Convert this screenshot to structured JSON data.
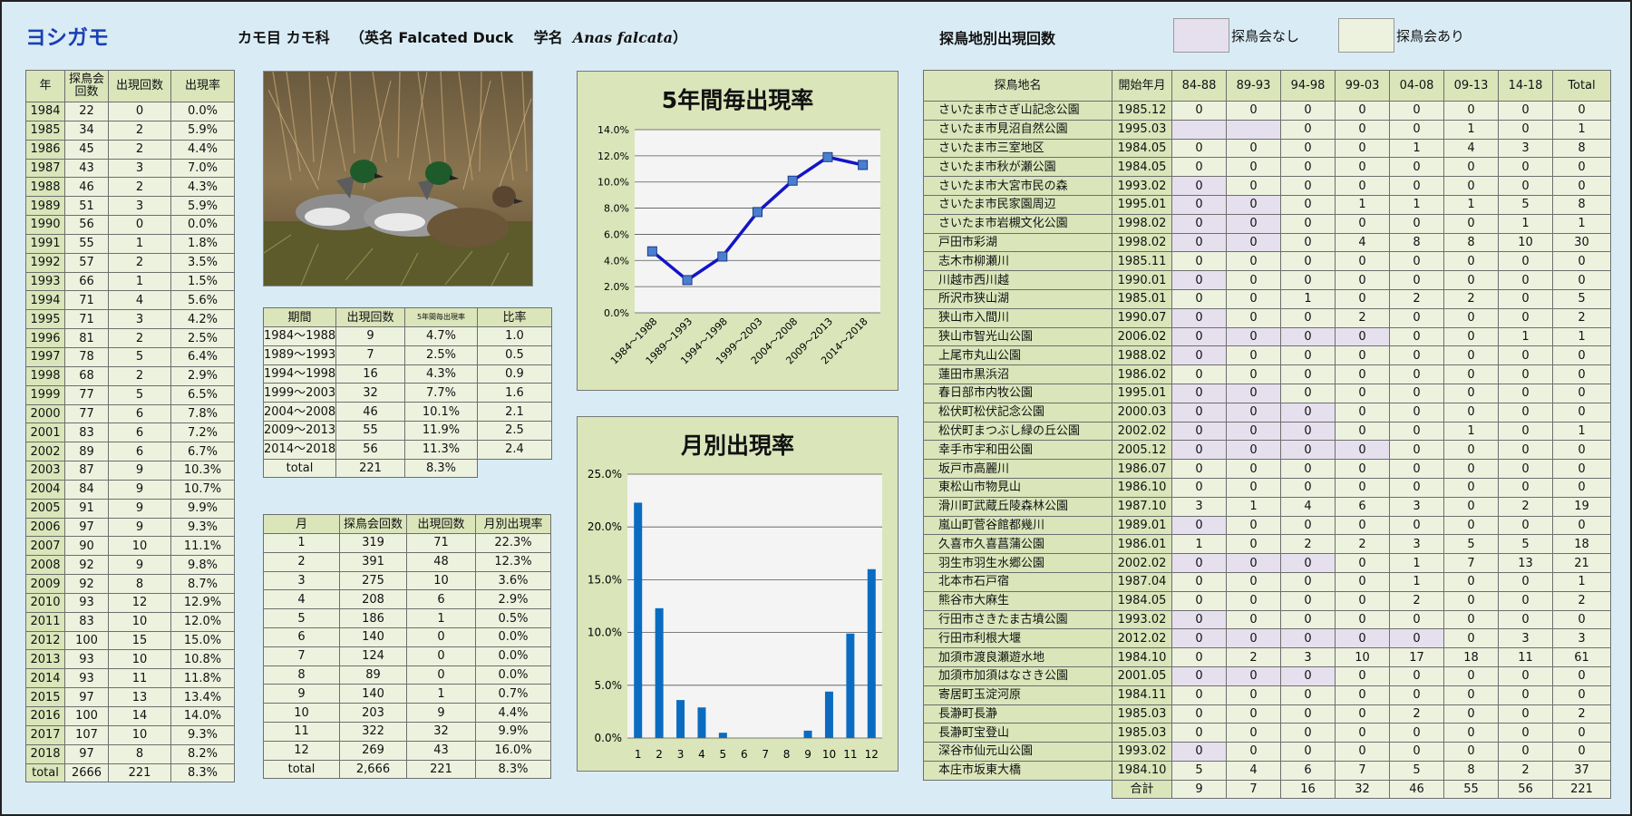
{
  "header": {
    "species": "ヨシガモ",
    "order_family": "カモ目 カモ科",
    "english_prefix": "（英名 Falcated Duck",
    "sci_prefix": "学名",
    "sci_name": "Anas falcata",
    "sci_suffix": "）",
    "site_table_title": "探鳥地別出現回数",
    "legend_none": "探鳥会なし",
    "legend_yes": "探鳥会あり",
    "legend_none_color": "#e6e0ee",
    "legend_yes_color": "#edf2df"
  },
  "yearly": {
    "headers": [
      "年",
      "探鳥会\n回数",
      "出現回数",
      "出現率"
    ],
    "rows": [
      [
        "1984",
        "22",
        "0",
        "0.0%"
      ],
      [
        "1985",
        "34",
        "2",
        "5.9%"
      ],
      [
        "1986",
        "45",
        "2",
        "4.4%"
      ],
      [
        "1987",
        "43",
        "3",
        "7.0%"
      ],
      [
        "1988",
        "46",
        "2",
        "4.3%"
      ],
      [
        "1989",
        "51",
        "3",
        "5.9%"
      ],
      [
        "1990",
        "56",
        "0",
        "0.0%"
      ],
      [
        "1991",
        "55",
        "1",
        "1.8%"
      ],
      [
        "1992",
        "57",
        "2",
        "3.5%"
      ],
      [
        "1993",
        "66",
        "1",
        "1.5%"
      ],
      [
        "1994",
        "71",
        "4",
        "5.6%"
      ],
      [
        "1995",
        "71",
        "3",
        "4.2%"
      ],
      [
        "1996",
        "81",
        "2",
        "2.5%"
      ],
      [
        "1997",
        "78",
        "5",
        "6.4%"
      ],
      [
        "1998",
        "68",
        "2",
        "2.9%"
      ],
      [
        "1999",
        "77",
        "5",
        "6.5%"
      ],
      [
        "2000",
        "77",
        "6",
        "7.8%"
      ],
      [
        "2001",
        "83",
        "6",
        "7.2%"
      ],
      [
        "2002",
        "89",
        "6",
        "6.7%"
      ],
      [
        "2003",
        "87",
        "9",
        "10.3%"
      ],
      [
        "2004",
        "84",
        "9",
        "10.7%"
      ],
      [
        "2005",
        "91",
        "9",
        "9.9%"
      ],
      [
        "2006",
        "97",
        "9",
        "9.3%"
      ],
      [
        "2007",
        "90",
        "10",
        "11.1%"
      ],
      [
        "2008",
        "92",
        "9",
        "9.8%"
      ],
      [
        "2009",
        "92",
        "8",
        "8.7%"
      ],
      [
        "2010",
        "93",
        "12",
        "12.9%"
      ],
      [
        "2011",
        "83",
        "10",
        "12.0%"
      ],
      [
        "2012",
        "100",
        "15",
        "15.0%"
      ],
      [
        "2013",
        "93",
        "10",
        "10.8%"
      ],
      [
        "2014",
        "93",
        "11",
        "11.8%"
      ],
      [
        "2015",
        "97",
        "13",
        "13.4%"
      ],
      [
        "2016",
        "100",
        "14",
        "14.0%"
      ],
      [
        "2017",
        "107",
        "10",
        "9.3%"
      ],
      [
        "2018",
        "97",
        "8",
        "8.2%"
      ]
    ],
    "total": [
      "total",
      "2666",
      "221",
      "8.3%"
    ]
  },
  "period": {
    "headers": [
      "期間",
      "出現回数",
      "5年間毎出現率",
      "比率"
    ],
    "rows": [
      [
        "1984～1988",
        "9",
        "4.7%",
        "1.0"
      ],
      [
        "1989～1993",
        "7",
        "2.5%",
        "0.5"
      ],
      [
        "1994～1998",
        "16",
        "4.3%",
        "0.9"
      ],
      [
        "1999～2003",
        "32",
        "7.7%",
        "1.6"
      ],
      [
        "2004～2008",
        "46",
        "10.1%",
        "2.1"
      ],
      [
        "2009～2013",
        "55",
        "11.9%",
        "2.5"
      ],
      [
        "2014～2018",
        "56",
        "11.3%",
        "2.4"
      ]
    ],
    "total": [
      "total",
      "221",
      "8.3%"
    ]
  },
  "monthly": {
    "headers": [
      "月",
      "探鳥会回数",
      "出現回数",
      "月別出現率"
    ],
    "rows": [
      [
        "1",
        "319",
        "71",
        "22.3%"
      ],
      [
        "2",
        "391",
        "48",
        "12.3%"
      ],
      [
        "3",
        "275",
        "10",
        "3.6%"
      ],
      [
        "4",
        "208",
        "6",
        "2.9%"
      ],
      [
        "5",
        "186",
        "1",
        "0.5%"
      ],
      [
        "6",
        "140",
        "0",
        "0.0%"
      ],
      [
        "7",
        "124",
        "0",
        "0.0%"
      ],
      [
        "8",
        "89",
        "0",
        "0.0%"
      ],
      [
        "9",
        "140",
        "1",
        "0.7%"
      ],
      [
        "10",
        "203",
        "9",
        "4.4%"
      ],
      [
        "11",
        "322",
        "32",
        "9.9%"
      ],
      [
        "12",
        "269",
        "43",
        "16.0%"
      ]
    ],
    "total": [
      "total",
      "2,666",
      "221",
      "8.3%"
    ]
  },
  "sites": {
    "headers": [
      "探鳥地名",
      "開始年月",
      "84-88",
      "89-93",
      "94-98",
      "99-03",
      "04-08",
      "09-13",
      "14-18",
      "Total"
    ],
    "rows": [
      {
        "name": "さいたま市さぎ山記念公園",
        "start": "1985.12",
        "v": [
          "0",
          "0",
          "0",
          "0",
          "0",
          "0",
          "0",
          "0"
        ],
        "none": []
      },
      {
        "name": "さいたま市見沼自然公園",
        "start": "1995.03",
        "v": [
          "",
          "",
          "0",
          "0",
          "0",
          "1",
          "0",
          "1"
        ],
        "none": [
          0,
          1
        ]
      },
      {
        "name": "さいたま市三室地区",
        "start": "1984.05",
        "v": [
          "0",
          "0",
          "0",
          "0",
          "1",
          "4",
          "3",
          "8"
        ],
        "none": []
      },
      {
        "name": "さいたま市秋が瀬公園",
        "start": "1984.05",
        "v": [
          "0",
          "0",
          "0",
          "0",
          "0",
          "0",
          "0",
          "0"
        ],
        "none": []
      },
      {
        "name": "さいたま市大宮市民の森",
        "start": "1993.02",
        "v": [
          "0",
          "0",
          "0",
          "0",
          "0",
          "0",
          "0",
          "0"
        ],
        "none": [
          0
        ]
      },
      {
        "name": "さいたま市民家園周辺",
        "start": "1995.01",
        "v": [
          "0",
          "0",
          "0",
          "1",
          "1",
          "1",
          "5",
          "8"
        ],
        "none": [
          0,
          1
        ]
      },
      {
        "name": "さいたま市岩槻文化公園",
        "start": "1998.02",
        "v": [
          "0",
          "0",
          "0",
          "0",
          "0",
          "0",
          "1",
          "1"
        ],
        "none": [
          0,
          1
        ]
      },
      {
        "name": "戸田市彩湖",
        "start": "1998.02",
        "v": [
          "0",
          "0",
          "0",
          "4",
          "8",
          "8",
          "10",
          "30"
        ],
        "none": [
          0,
          1
        ]
      },
      {
        "name": "志木市柳瀬川",
        "start": "1985.11",
        "v": [
          "0",
          "0",
          "0",
          "0",
          "0",
          "0",
          "0",
          "0"
        ],
        "none": []
      },
      {
        "name": "川越市西川越",
        "start": "1990.01",
        "v": [
          "0",
          "0",
          "0",
          "0",
          "0",
          "0",
          "0",
          "0"
        ],
        "none": [
          0
        ]
      },
      {
        "name": "所沢市狭山湖",
        "start": "1985.01",
        "v": [
          "0",
          "0",
          "1",
          "0",
          "2",
          "2",
          "0",
          "5"
        ],
        "none": []
      },
      {
        "name": "狭山市入間川",
        "start": "1990.07",
        "v": [
          "0",
          "0",
          "0",
          "2",
          "0",
          "0",
          "0",
          "2"
        ],
        "none": [
          0
        ]
      },
      {
        "name": "狭山市智光山公園",
        "start": "2006.02",
        "v": [
          "0",
          "0",
          "0",
          "0",
          "0",
          "0",
          "1",
          "1"
        ],
        "none": [
          0,
          1,
          2,
          3
        ]
      },
      {
        "name": "上尾市丸山公園",
        "start": "1988.02",
        "v": [
          "0",
          "0",
          "0",
          "0",
          "0",
          "0",
          "0",
          "0"
        ],
        "none": [
          0
        ]
      },
      {
        "name": "蓮田市黒浜沼",
        "start": "1986.02",
        "v": [
          "0",
          "0",
          "0",
          "0",
          "0",
          "0",
          "0",
          "0"
        ],
        "none": []
      },
      {
        "name": "春日部市内牧公園",
        "start": "1995.01",
        "v": [
          "0",
          "0",
          "0",
          "0",
          "0",
          "0",
          "0",
          "0"
        ],
        "none": [
          0,
          1
        ]
      },
      {
        "name": "松伏町松伏記念公園",
        "start": "2000.03",
        "v": [
          "0",
          "0",
          "0",
          "0",
          "0",
          "0",
          "0",
          "0"
        ],
        "none": [
          0,
          1,
          2
        ]
      },
      {
        "name": "松伏町まつぶし緑の丘公園",
        "start": "2002.02",
        "v": [
          "0",
          "0",
          "0",
          "0",
          "0",
          "1",
          "0",
          "1"
        ],
        "none": [
          0,
          1,
          2
        ]
      },
      {
        "name": "幸手市宇和田公園",
        "start": "2005.12",
        "v": [
          "0",
          "0",
          "0",
          "0",
          "0",
          "0",
          "0",
          "0"
        ],
        "none": [
          0,
          1,
          2,
          3
        ]
      },
      {
        "name": "坂戸市高麗川",
        "start": "1986.07",
        "v": [
          "0",
          "0",
          "0",
          "0",
          "0",
          "0",
          "0",
          "0"
        ],
        "none": []
      },
      {
        "name": "東松山市物見山",
        "start": "1986.10",
        "v": [
          "0",
          "0",
          "0",
          "0",
          "0",
          "0",
          "0",
          "0"
        ],
        "none": []
      },
      {
        "name": "滑川町武蔵丘陵森林公園",
        "start": "1987.10",
        "v": [
          "3",
          "1",
          "4",
          "6",
          "3",
          "0",
          "2",
          "19"
        ],
        "none": []
      },
      {
        "name": "嵐山町菅谷館都幾川",
        "start": "1989.01",
        "v": [
          "0",
          "0",
          "0",
          "0",
          "0",
          "0",
          "0",
          "0"
        ],
        "none": [
          0
        ]
      },
      {
        "name": "久喜市久喜菖蒲公園",
        "start": "1986.01",
        "v": [
          "1",
          "0",
          "2",
          "2",
          "3",
          "5",
          "5",
          "18"
        ],
        "none": []
      },
      {
        "name": "羽生市羽生水郷公園",
        "start": "2002.02",
        "v": [
          "0",
          "0",
          "0",
          "0",
          "1",
          "7",
          "13",
          "21"
        ],
        "none": [
          0,
          1,
          2
        ]
      },
      {
        "name": "北本市石戸宿",
        "start": "1987.04",
        "v": [
          "0",
          "0",
          "0",
          "0",
          "1",
          "0",
          "0",
          "1"
        ],
        "none": []
      },
      {
        "name": "熊谷市大麻生",
        "start": "1984.05",
        "v": [
          "0",
          "0",
          "0",
          "0",
          "2",
          "0",
          "0",
          "2"
        ],
        "none": []
      },
      {
        "name": "行田市さきたま古墳公園",
        "start": "1993.02",
        "v": [
          "0",
          "0",
          "0",
          "0",
          "0",
          "0",
          "0",
          "0"
        ],
        "none": [
          0
        ]
      },
      {
        "name": "行田市利根大堰",
        "start": "2012.02",
        "v": [
          "0",
          "0",
          "0",
          "0",
          "0",
          "0",
          "3",
          "3"
        ],
        "none": [
          0,
          1,
          2,
          3,
          4
        ]
      },
      {
        "name": "加須市渡良瀬遊水地",
        "start": "1984.10",
        "v": [
          "0",
          "2",
          "3",
          "10",
          "17",
          "18",
          "11",
          "61"
        ],
        "none": []
      },
      {
        "name": "加須市加須はなさき公園",
        "start": "2001.05",
        "v": [
          "0",
          "0",
          "0",
          "0",
          "0",
          "0",
          "0",
          "0"
        ],
        "none": [
          0,
          1,
          2
        ]
      },
      {
        "name": "寄居町玉淀河原",
        "start": "1984.11",
        "v": [
          "0",
          "0",
          "0",
          "0",
          "0",
          "0",
          "0",
          "0"
        ],
        "none": []
      },
      {
        "name": "長瀞町長瀞",
        "start": "1985.03",
        "v": [
          "0",
          "0",
          "0",
          "0",
          "2",
          "0",
          "0",
          "2"
        ],
        "none": []
      },
      {
        "name": "長瀞町宝登山",
        "start": "1985.03",
        "v": [
          "0",
          "0",
          "0",
          "0",
          "0",
          "0",
          "0",
          "0"
        ],
        "none": []
      },
      {
        "name": "深谷市仙元山公園",
        "start": "1993.02",
        "v": [
          "0",
          "0",
          "0",
          "0",
          "0",
          "0",
          "0",
          "0"
        ],
        "none": [
          0
        ]
      },
      {
        "name": "本庄市坂東大橋",
        "start": "1984.10",
        "v": [
          "5",
          "4",
          "6",
          "7",
          "5",
          "8",
          "2",
          "37"
        ],
        "none": []
      }
    ],
    "total_label": "合計",
    "totals": [
      "9",
      "7",
      "16",
      "32",
      "46",
      "55",
      "56",
      "221"
    ]
  },
  "chart_data": [
    {
      "type": "line",
      "title": "5年間毎出現率",
      "categories": [
        "1984～1988",
        "1989～1993",
        "1994～1998",
        "1999～2003",
        "2004～2008",
        "2009～2013",
        "2014～2018"
      ],
      "values": [
        4.7,
        2.5,
        4.3,
        7.7,
        10.1,
        11.9,
        11.3
      ],
      "ylim": [
        0,
        14
      ],
      "yticks": [
        "0.0%",
        "2.0%",
        "4.0%",
        "6.0%",
        "8.0%",
        "10.0%",
        "12.0%",
        "14.0%"
      ],
      "color": "#1414c8",
      "grid": true
    },
    {
      "type": "bar",
      "title": "月別出現率",
      "categories": [
        "1",
        "2",
        "3",
        "4",
        "5",
        "6",
        "7",
        "8",
        "9",
        "10",
        "11",
        "12"
      ],
      "values": [
        22.3,
        12.3,
        3.6,
        2.9,
        0.5,
        0.0,
        0.0,
        0.0,
        0.7,
        4.4,
        9.9,
        16.0
      ],
      "ylim": [
        0,
        25
      ],
      "yticks": [
        "0.0%",
        "5.0%",
        "10.0%",
        "15.0%",
        "20.0%",
        "25.0%"
      ],
      "color": "#0a6cc0",
      "grid": true
    }
  ]
}
